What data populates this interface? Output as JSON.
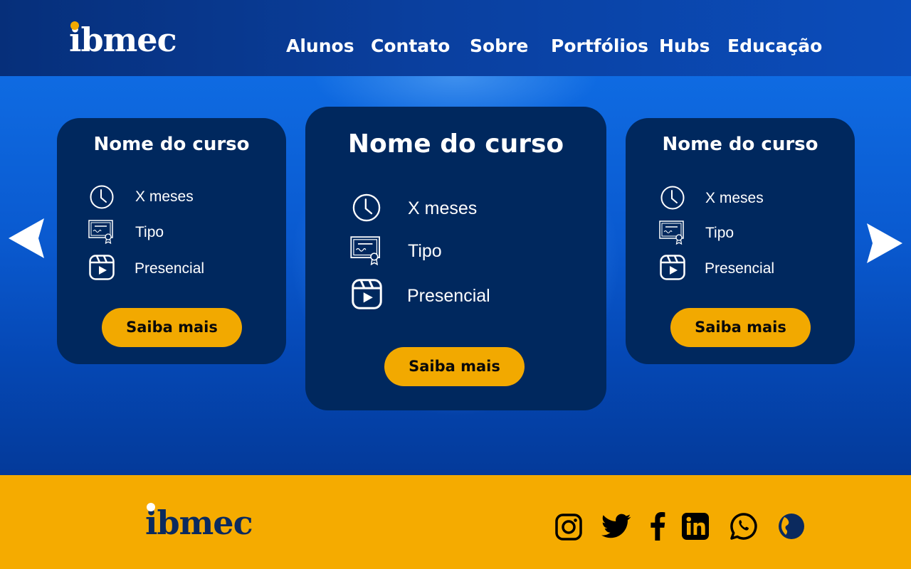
{
  "header": {
    "logo_text": "ibmec",
    "nav": [
      "Alunos",
      "Contato",
      "Sobre",
      "Portfólios",
      "Hubs",
      "Educação"
    ]
  },
  "cards": [
    {
      "title": "Nome do curso",
      "duration": "X meses",
      "type": "Tipo",
      "mode": "Presencial",
      "button": "Saiba mais"
    },
    {
      "title": "Nome do curso",
      "duration": "X meses",
      "type": "Tipo",
      "mode": "Presencial",
      "button": "Saiba mais"
    },
    {
      "title": "Nome do curso",
      "duration": "X meses",
      "type": "Tipo",
      "mode": "Presencial",
      "button": "Saiba mais"
    }
  ],
  "carousel": {
    "prev_icon": "arrow-left-icon",
    "next_icon": "arrow-right-icon"
  },
  "footer": {
    "logo_text": "ibmec",
    "social": [
      "instagram-icon",
      "twitter-icon",
      "facebook-icon",
      "linkedin-icon",
      "whatsapp-icon",
      "globe-icon"
    ]
  },
  "colors": {
    "brand_blue": "#00285e",
    "accent_yellow": "#f2a900",
    "footer_yellow": "#f5ab00",
    "hero_blue": "#0a5ad0"
  }
}
